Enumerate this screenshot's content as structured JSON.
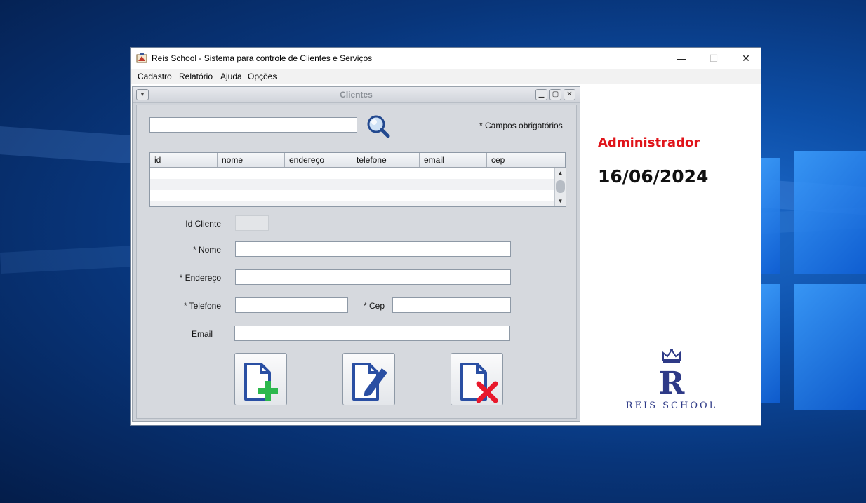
{
  "window": {
    "title": "Reis School - Sistema para controle de Clientes e Serviços",
    "controls": {
      "minimize": "—",
      "maximize": "☐",
      "close": "✕"
    }
  },
  "menu": {
    "items": [
      "Cadastro",
      "Relatório",
      "Ajuda",
      "Opções"
    ]
  },
  "internal_frame": {
    "title": "Clientes",
    "search": {
      "value": "",
      "placeholder": ""
    },
    "required_note": "* Campos obrigatórios",
    "table": {
      "columns": [
        "id",
        "nome",
        "endereço",
        "telefone",
        "email",
        "cep"
      ],
      "rows": []
    },
    "form": {
      "id_label": "Id Cliente",
      "nome_label": "* Nome",
      "endereco_label": "* Endereço",
      "telefone_label": "* Telefone",
      "cep_label": "* Cep",
      "email_label": "Email",
      "nome_value": "",
      "endereco_value": "",
      "telefone_value": "",
      "cep_value": "",
      "email_value": ""
    },
    "buttons": [
      {
        "name": "add-client-button",
        "icon": "document-plus-icon"
      },
      {
        "name": "edit-client-button",
        "icon": "document-pen-icon"
      },
      {
        "name": "delete-client-button",
        "icon": "document-x-icon"
      }
    ]
  },
  "side_panel": {
    "user": "Administrador",
    "date": "16/06/2024",
    "logo_text": "REIS SCHOOL",
    "logo_letter": "R"
  },
  "colors": {
    "user_text": "#e0141a",
    "logo": "#2e3a87",
    "add_accent": "#2db84d",
    "delete_accent": "#e8192c",
    "doc_blue": "#2a4fa3"
  }
}
